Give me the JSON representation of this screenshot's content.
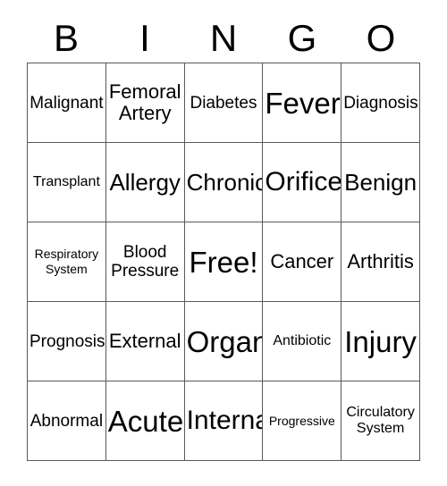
{
  "card": {
    "title": "BINGO",
    "header_letters": [
      "B",
      "I",
      "N",
      "G",
      "O"
    ],
    "columns": 5,
    "rows": 5,
    "free_space_label": "Free!",
    "free_space_position": {
      "row": 3,
      "column": 3
    },
    "colors": {
      "background": "#ffffff",
      "text": "#000000",
      "grid_line": "#595959"
    },
    "cells": [
      {
        "text": "Malignant",
        "size": "sm",
        "column": "B",
        "row": 1
      },
      {
        "text": "Femoral\nArtery",
        "size": "md",
        "column": "I",
        "row": 1
      },
      {
        "text": "Diabetes",
        "size": "sm",
        "column": "N",
        "row": 1
      },
      {
        "text": "Fever",
        "size": "xxl",
        "column": "G",
        "row": 1
      },
      {
        "text": "Diagnosis",
        "size": "sm",
        "column": "O",
        "row": 1
      },
      {
        "text": "Transplant",
        "size": "xs",
        "column": "B",
        "row": 2
      },
      {
        "text": "Allergy",
        "size": "lg",
        "column": "I",
        "row": 2
      },
      {
        "text": "Chronic",
        "size": "lg",
        "column": "N",
        "row": 2
      },
      {
        "text": "Orifice",
        "size": "xl",
        "column": "G",
        "row": 2
      },
      {
        "text": "Benign",
        "size": "lg",
        "column": "O",
        "row": 2
      },
      {
        "text": "Respiratory\nSystem",
        "size": "xxs",
        "column": "B",
        "row": 3
      },
      {
        "text": "Blood\nPressure",
        "size": "sm",
        "column": "I",
        "row": 3
      },
      {
        "text": "Free!",
        "size": "xxl",
        "column": "N",
        "row": 3
      },
      {
        "text": "Cancer",
        "size": "md",
        "column": "G",
        "row": 3
      },
      {
        "text": "Arthritis",
        "size": "md",
        "column": "O",
        "row": 3
      },
      {
        "text": "Prognosis",
        "size": "sm",
        "column": "B",
        "row": 4
      },
      {
        "text": "External",
        "size": "md",
        "column": "I",
        "row": 4
      },
      {
        "text": "Organ",
        "size": "xxl",
        "column": "N",
        "row": 4
      },
      {
        "text": "Antibiotic",
        "size": "xs",
        "column": "G",
        "row": 4
      },
      {
        "text": "Injury",
        "size": "xxl",
        "column": "O",
        "row": 4
      },
      {
        "text": "Abnormal",
        "size": "sm",
        "column": "B",
        "row": 5
      },
      {
        "text": "Acute",
        "size": "xxl",
        "column": "I",
        "row": 5
      },
      {
        "text": "Internal",
        "size": "xl",
        "column": "N",
        "row": 5
      },
      {
        "text": "Progressive",
        "size": "xxs",
        "column": "G",
        "row": 5
      },
      {
        "text": "Circulatory\nSystem",
        "size": "xs",
        "column": "O",
        "row": 5
      }
    ]
  }
}
